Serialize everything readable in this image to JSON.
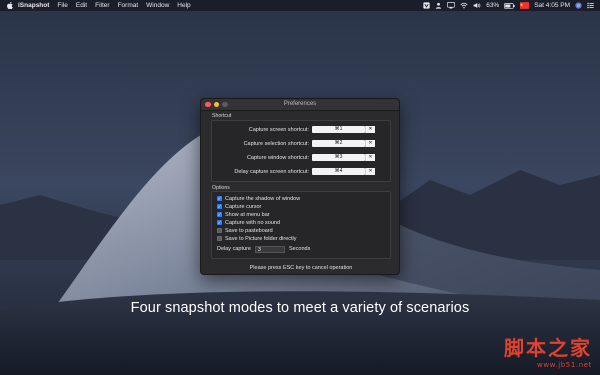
{
  "menubar": {
    "app_name": "iSnapshot",
    "menus": [
      "File",
      "Edit",
      "Filter",
      "Format",
      "Window",
      "Help"
    ],
    "battery": "63%",
    "clock": "Sat 4:05 PM"
  },
  "window": {
    "title": "Preferences",
    "shortcut_group": {
      "title": "Shortcut",
      "rows": [
        {
          "label": "Capture screen shortcut:",
          "key": "⌘1",
          "clear": "✕"
        },
        {
          "label": "Capture selection shortcut:",
          "key": "⌘2",
          "clear": "✕"
        },
        {
          "label": "Capture window shortcut:",
          "key": "⌘3",
          "clear": "✕"
        },
        {
          "label": "Delay capture screen shortcut:",
          "key": "⌘4",
          "clear": "✕"
        }
      ]
    },
    "options_group": {
      "title": "Options",
      "items": [
        {
          "label": "Capture the shadow of window",
          "checked": true
        },
        {
          "label": "Capture cursor",
          "checked": true
        },
        {
          "label": "Show at menu bar",
          "checked": true
        },
        {
          "label": "Capture with no sound",
          "checked": true
        },
        {
          "label": "Save to pasteboard",
          "checked": false
        },
        {
          "label": "Save to Picture folder directly",
          "checked": false
        }
      ],
      "delay_label": "Delay capture",
      "delay_value": "3",
      "delay_unit": "Seconds"
    },
    "footer": "Please press ESC key to cancel operation"
  },
  "caption": "Four snapshot modes to meet a variety of scenarios",
  "watermark": {
    "chinese": "脚本之家",
    "url": "www.jb51.net"
  },
  "colors": {
    "checkbox_on": "#2f7ef6",
    "close": "#fd5d57",
    "minimize": "#fcbc2e",
    "watermark": "#e1412e"
  }
}
